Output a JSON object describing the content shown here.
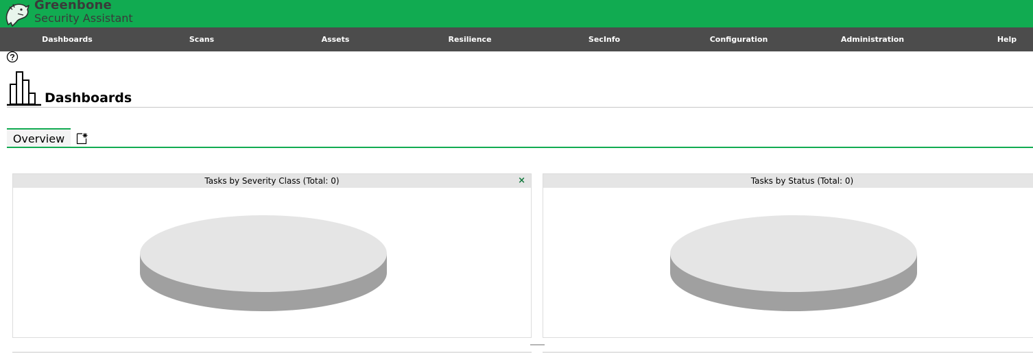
{
  "brand": {
    "title": "Greenbone",
    "subtitle": "Security Assistant",
    "logo_icon": "greenbone-dragon-logo-icon",
    "accent_color": "#11ab51"
  },
  "menu": {
    "items": [
      {
        "label": "Dashboards"
      },
      {
        "label": "Scans"
      },
      {
        "label": "Assets"
      },
      {
        "label": "Resilience"
      },
      {
        "label": "SecInfo"
      },
      {
        "label": "Configuration"
      },
      {
        "label": "Administration"
      },
      {
        "label": "Help"
      }
    ],
    "background_color": "#4c4c4c"
  },
  "page": {
    "title": "Dashboards",
    "help_icon": "help-circle-icon",
    "page_icon": "bar-chart-icon"
  },
  "tabs": {
    "items": [
      {
        "label": "Overview",
        "active": true
      }
    ],
    "add_icon": "new-dashboard-icon"
  },
  "panels": [
    {
      "title": "Tasks by Severity Class (Total: 0)",
      "close_label": "×",
      "chart_type": "empty-3d-pie"
    },
    {
      "title": "Tasks by Status (Total: 0)",
      "chart_type": "empty-3d-pie"
    }
  ],
  "pie_colors": {
    "top": "#e5e5e5",
    "side": "#a0a0a0"
  }
}
